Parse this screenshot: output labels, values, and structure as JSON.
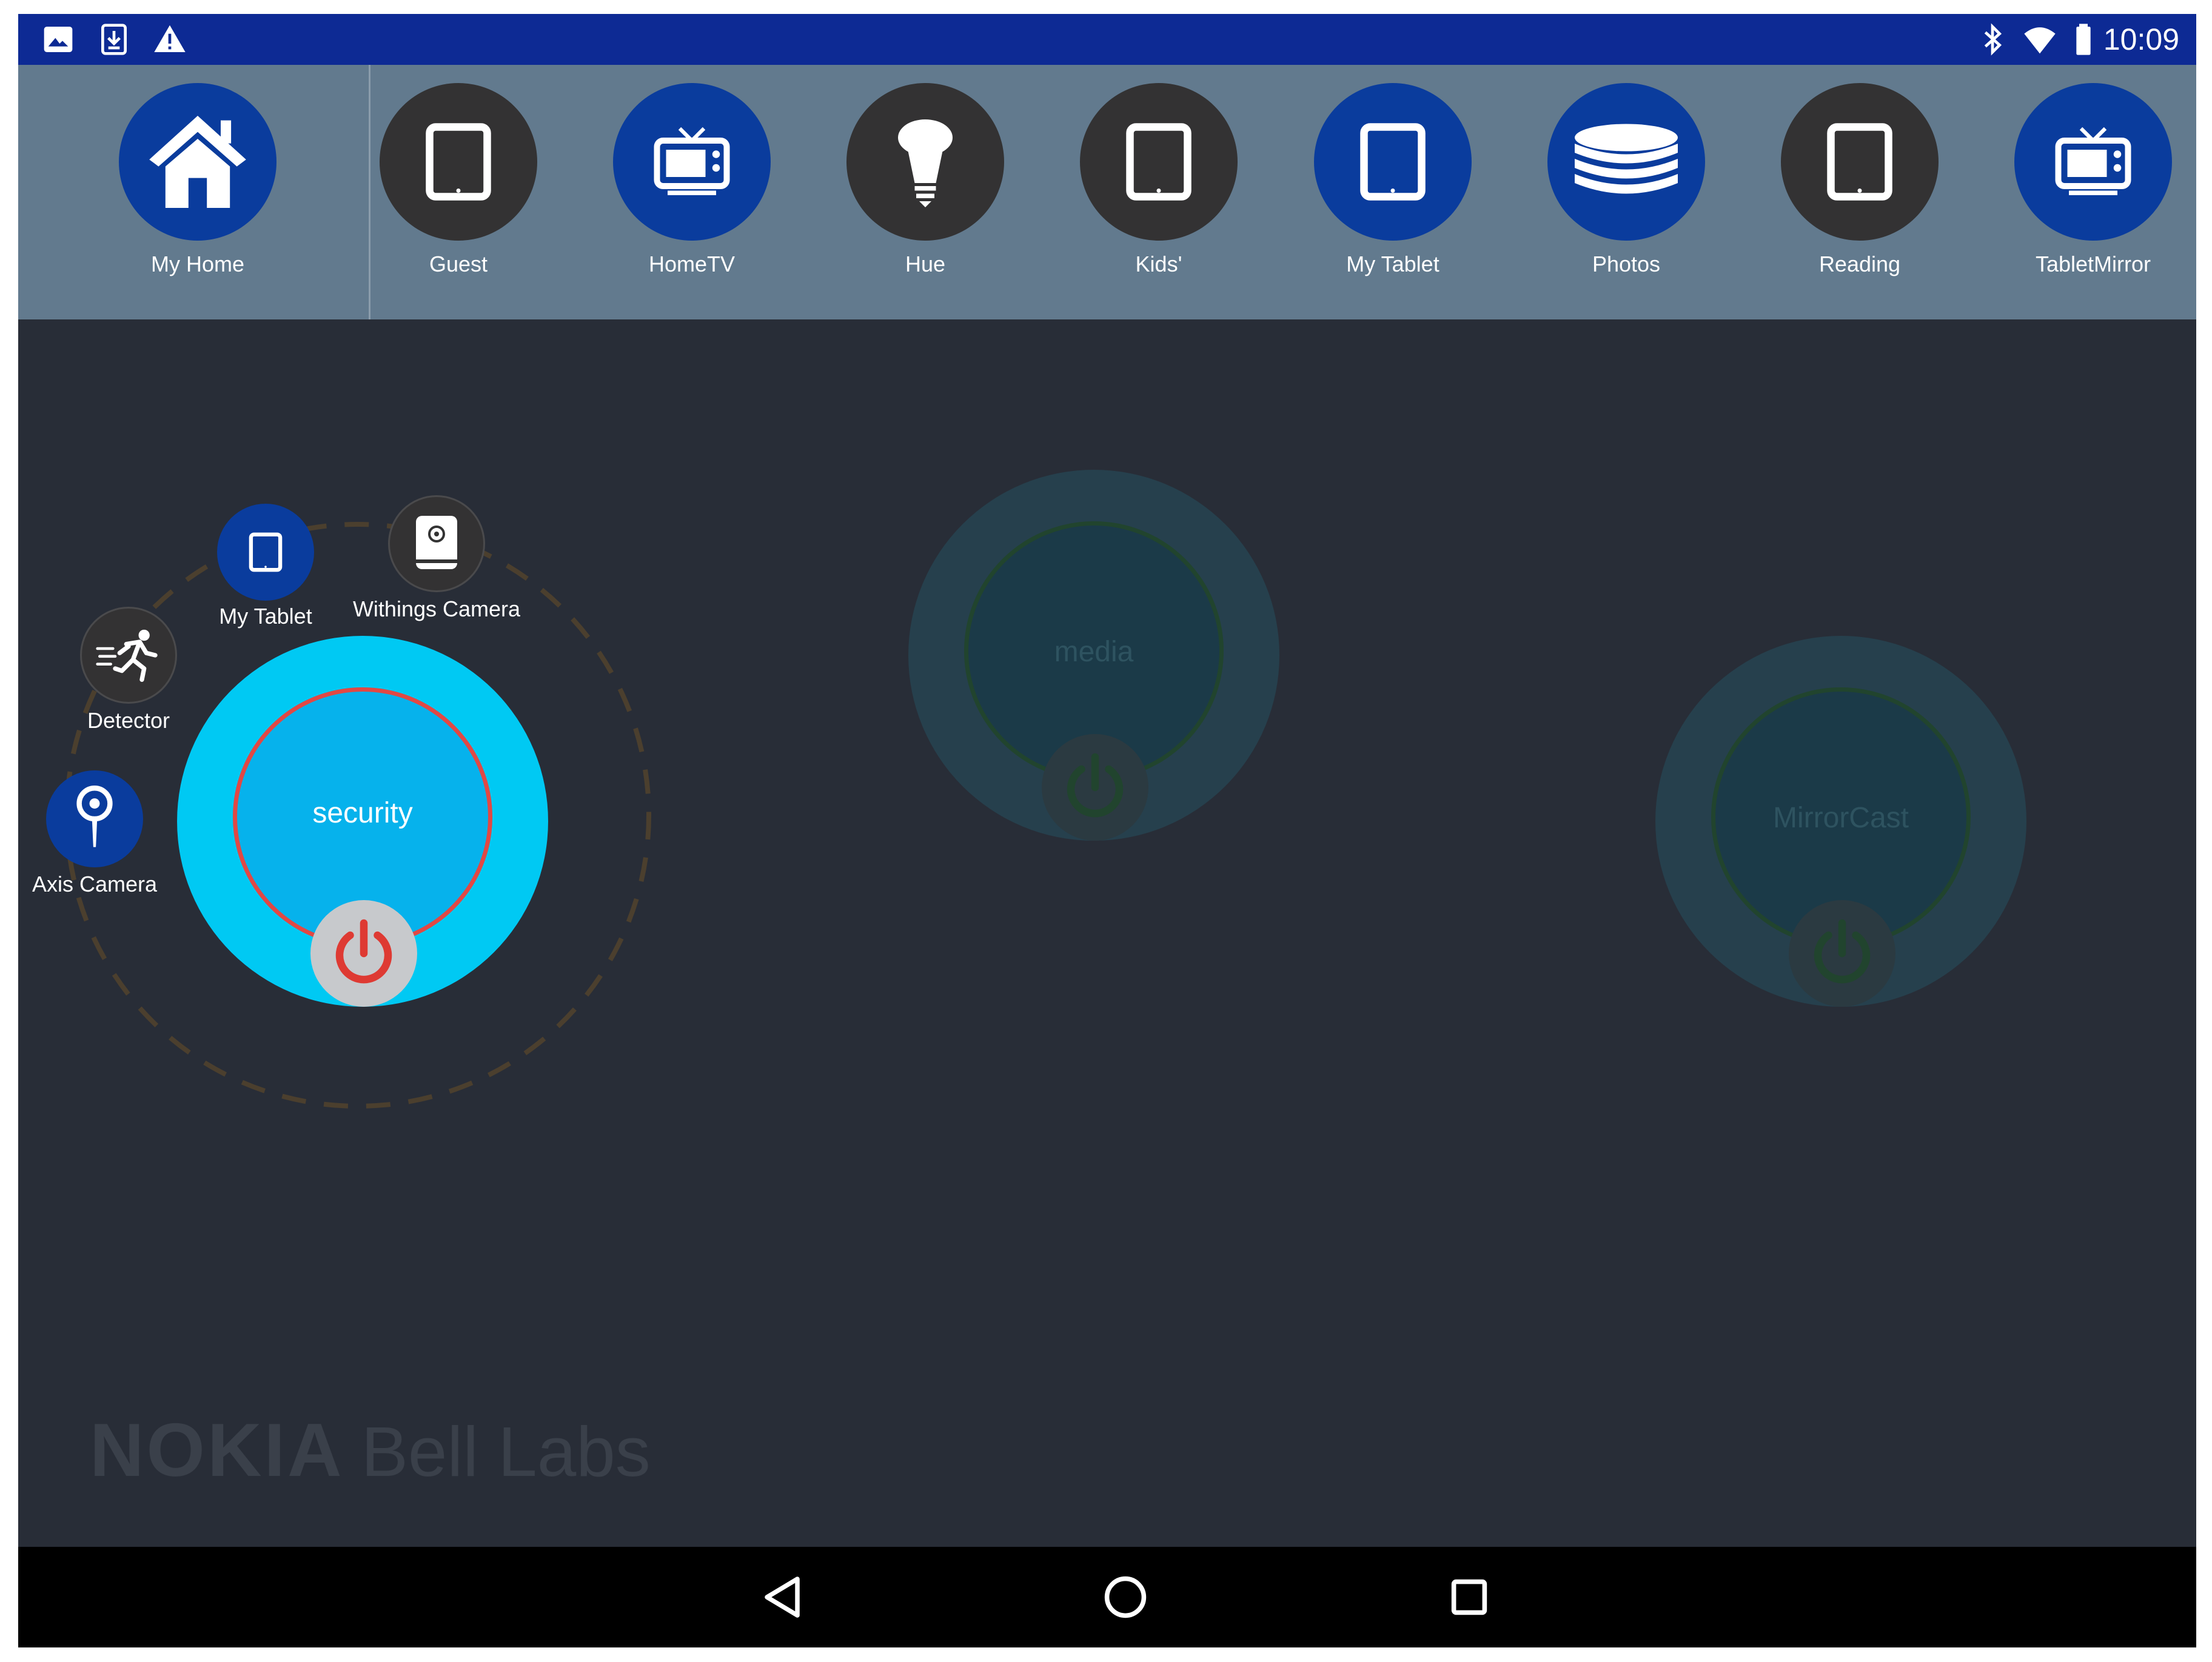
{
  "status_bar": {
    "left_icons": [
      "image-icon",
      "download-icon",
      "warning-icon"
    ],
    "right_icons": [
      "bluetooth-icon",
      "wifi-icon",
      "battery-icon"
    ],
    "time": "10:09"
  },
  "device_bar": {
    "home": {
      "label": "My Home",
      "icon": "home-icon",
      "style": "blue"
    },
    "devices": [
      {
        "label": "Guest",
        "icon": "tablet-icon",
        "style": "dark"
      },
      {
        "label": "HomeTV",
        "icon": "tv-icon",
        "style": "blue"
      },
      {
        "label": "Hue",
        "icon": "bulb-icon",
        "style": "dark"
      },
      {
        "label": "Kids'",
        "icon": "tablet-icon",
        "style": "dark"
      },
      {
        "label": "My Tablet",
        "icon": "tablet-icon",
        "style": "blue"
      },
      {
        "label": "Photos",
        "icon": "database-icon",
        "style": "blue"
      },
      {
        "label": "Reading",
        "icon": "tablet-icon",
        "style": "dark"
      },
      {
        "label": "TabletMirror",
        "icon": "tv-icon",
        "style": "blue"
      }
    ]
  },
  "scenes": {
    "security": {
      "label": "security",
      "state": "active",
      "members": [
        {
          "label": "My Tablet",
          "icon": "tablet-icon"
        },
        {
          "label": "Withings Camera",
          "icon": "camera-icon"
        },
        {
          "label": "Detector",
          "icon": "motion-icon"
        },
        {
          "label": "Axis Camera",
          "icon": "location-camera-icon"
        }
      ]
    },
    "media": {
      "label": "media",
      "state": "inactive"
    },
    "mirrorcast": {
      "label": "MirrorCast",
      "state": "inactive"
    }
  },
  "branding": {
    "brand": "NOKIA",
    "suffix": "Bell Labs"
  },
  "nav_bar": {
    "buttons": [
      "back-icon",
      "home-icon",
      "recents-icon"
    ]
  },
  "colors": {
    "status_bar": "#0d2a94",
    "device_bar": "#627a8e",
    "canvas": "#282d37",
    "device_blue": "#0a3c9d",
    "device_dark": "#333233",
    "security_outer": "#00c9f3",
    "security_inner": "#06b2ec",
    "security_ring": "#e14844",
    "power_red": "#de3a33",
    "inactive_scene": "#26404d",
    "dashed_orbit": "#4b3f2e"
  }
}
